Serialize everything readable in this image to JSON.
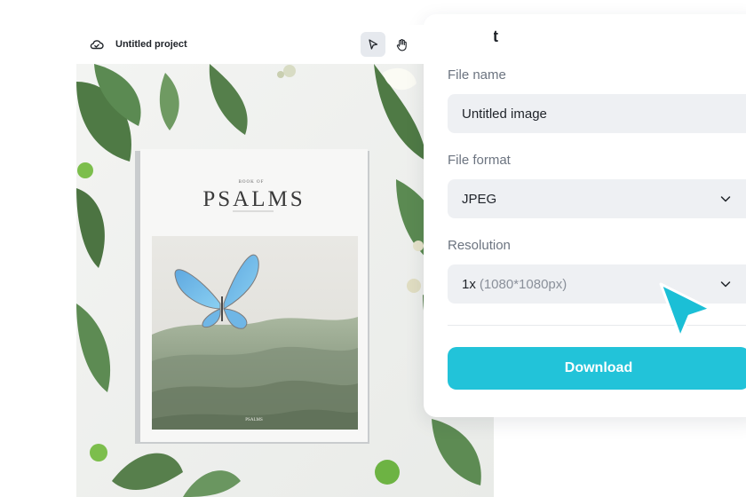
{
  "editor": {
    "project_title": "Untitled project",
    "icons": {
      "cloud": "cloud-icon",
      "select_tool": "cursor-arrow-icon",
      "hand_tool": "hand-icon"
    }
  },
  "canvas": {
    "book": {
      "overline": "BOOK OF",
      "title": "PSALMS",
      "publisher": "PSALMS",
      "image": "butterfly-over-green-hills"
    }
  },
  "export": {
    "title": "Export",
    "file_name": {
      "label": "File name",
      "value": "Untitled image"
    },
    "file_format": {
      "label": "File format",
      "selected": "JPEG"
    },
    "resolution": {
      "label": "Resolution",
      "selected": "1x",
      "detail": "(1080*1080px)"
    },
    "download_label": "Download"
  },
  "colors": {
    "accent": "#22c3d9",
    "field_bg": "#eef0f3",
    "label": "#6c7480"
  }
}
